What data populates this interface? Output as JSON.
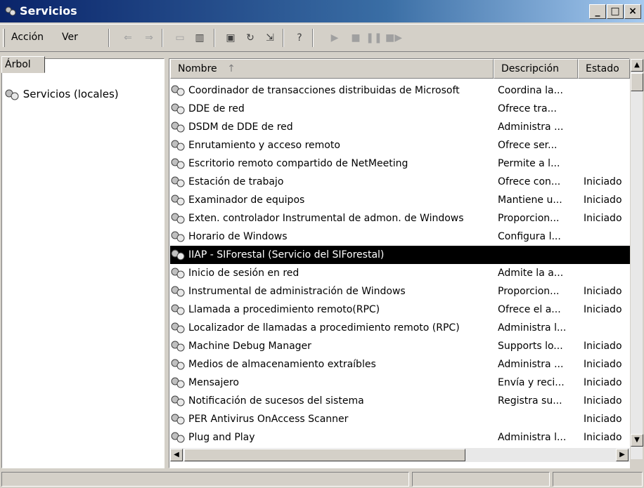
{
  "window": {
    "title": "Servicios"
  },
  "menu": {
    "action": "Acción",
    "view": "Ver"
  },
  "toolbar_icons": [
    "back-arrow-icon",
    "forward-arrow-icon",
    "up-folder-icon",
    "show-hide-tree-icon",
    "properties-icon",
    "refresh-icon",
    "export-list-icon",
    "help-icon",
    "start-service-icon",
    "stop-service-icon",
    "pause-service-icon",
    "restart-service-icon"
  ],
  "tree": {
    "tab_label": "Árbol",
    "root": "Servicios (locales)"
  },
  "list": {
    "columns": {
      "name": "Nombre",
      "description": "Descripción",
      "state": "Estado"
    },
    "rows": [
      {
        "name": "Coordinador de transacciones distribuidas de Microsoft",
        "description": "Coordina la...",
        "state": ""
      },
      {
        "name": "DDE de red",
        "description": "Ofrece tra...",
        "state": ""
      },
      {
        "name": "DSDM de DDE de red",
        "description": "Administra ...",
        "state": ""
      },
      {
        "name": "Enrutamiento y acceso remoto",
        "description": "Ofrece ser...",
        "state": ""
      },
      {
        "name": "Escritorio remoto compartido de NetMeeting",
        "description": "Permite a l...",
        "state": ""
      },
      {
        "name": "Estación de trabajo",
        "description": "Ofrece con...",
        "state": "Iniciado"
      },
      {
        "name": "Examinador de equipos",
        "description": "Mantiene u...",
        "state": "Iniciado"
      },
      {
        "name": "Exten. controlador Instrumental de admon. de Windows",
        "description": "Proporcion...",
        "state": "Iniciado"
      },
      {
        "name": "Horario de Windows",
        "description": "Configura l...",
        "state": ""
      },
      {
        "name": "IIAP - SIForestal (Servicio del SIForestal)",
        "description": "",
        "state": ""
      },
      {
        "name": "Inicio de sesión en red",
        "description": "Admite la a...",
        "state": ""
      },
      {
        "name": "Instrumental de administración de Windows",
        "description": "Proporcion...",
        "state": "Iniciado"
      },
      {
        "name": "Llamada a procedimiento remoto(RPC)",
        "description": "Ofrece el a...",
        "state": "Iniciado"
      },
      {
        "name": "Localizador de llamadas a procedimiento remoto (RPC)",
        "description": "Administra l...",
        "state": ""
      },
      {
        "name": "Machine Debug Manager",
        "description": "Supports lo...",
        "state": "Iniciado"
      },
      {
        "name": "Medios de almacenamiento extraíbles",
        "description": "Administra ...",
        "state": "Iniciado"
      },
      {
        "name": "Mensajero",
        "description": "Envía y reci...",
        "state": "Iniciado"
      },
      {
        "name": "Notificación de sucesos del sistema",
        "description": "Registra su...",
        "state": "Iniciado"
      },
      {
        "name": "PER Antivirus OnAccess Scanner",
        "description": "",
        "state": "Iniciado"
      },
      {
        "name": "Plug and Play",
        "description": "Administra l...",
        "state": "Iniciado"
      }
    ],
    "selected_index": 9
  },
  "colors": {
    "selection": "#000000",
    "titlebar": "#0a246a",
    "face": "#d4d0c8"
  }
}
